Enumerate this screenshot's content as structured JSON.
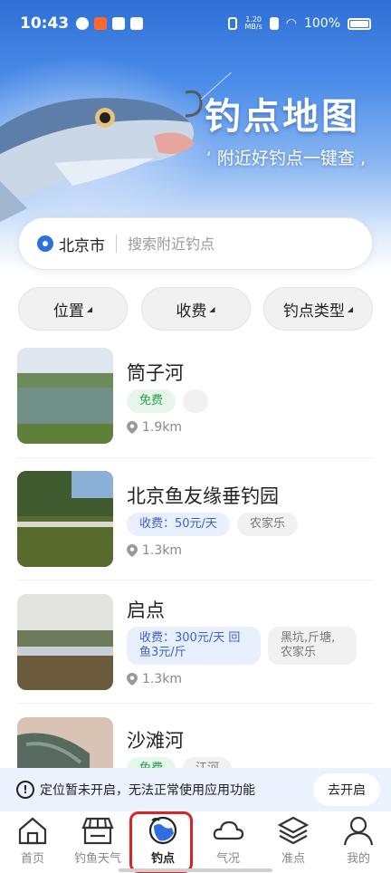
{
  "status_bar": {
    "time": "10:43",
    "net_speed_value": "1.20",
    "net_speed_unit": "MB/s",
    "battery": "100%"
  },
  "banner": {
    "title": "钓点地图",
    "subtitle": "附近好钓点一键查"
  },
  "search": {
    "city": "北京市",
    "placeholder": "搜索附近钓点"
  },
  "filters": [
    {
      "label": "位置"
    },
    {
      "label": "收费"
    },
    {
      "label": "钓点类型"
    }
  ],
  "spots": [
    {
      "name": "筒子河",
      "tags": [
        "免费",
        ""
      ],
      "distance": "1.9km"
    },
    {
      "name": "北京鱼友缘垂钓园",
      "tags": [
        "收费：50元/天",
        "农家乐"
      ],
      "distance": "1.3km"
    },
    {
      "name": "启点",
      "tags": [
        "收费：300元/天 回鱼3元/斤",
        "黑坑,斤塘,农家乐"
      ],
      "distance": "1.3km"
    },
    {
      "name": "沙滩河",
      "tags": [
        "免费",
        "江河"
      ],
      "distance": ""
    }
  ],
  "notice": {
    "text": "定位暂未开启，无法正常使用应用功能",
    "button": "去开启"
  },
  "tabbar": [
    {
      "label": "首页",
      "icon": "home-icon"
    },
    {
      "label": "钓鱼天气",
      "icon": "shop-icon"
    },
    {
      "label": "钓点",
      "icon": "globe-icon"
    },
    {
      "label": "气况",
      "icon": "cloud-icon"
    },
    {
      "label": "准点",
      "icon": "layers-icon"
    },
    {
      "label": "我的",
      "icon": "profile-icon"
    }
  ],
  "colors": {
    "accent": "#2f6fe0",
    "free_tag": "#2e9c4a",
    "fee_tag": "#3e63c7",
    "active_ring": "#d82424"
  }
}
